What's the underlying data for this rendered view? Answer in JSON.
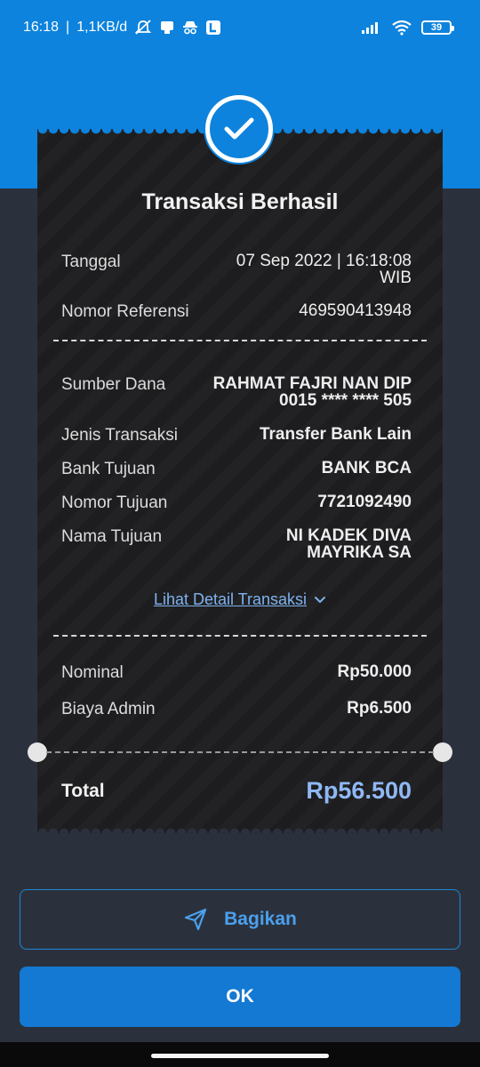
{
  "status_bar": {
    "time": "16:18",
    "separator": "|",
    "speed": "1,1KB/d",
    "battery": "39"
  },
  "receipt": {
    "title": "Transaksi Berhasil",
    "rows_top": [
      {
        "label": "Tanggal",
        "value_lines": [
          "07 Sep 2022 | 16:18:08",
          "WIB"
        ]
      },
      {
        "label": "Nomor Referensi",
        "value_lines": [
          "469590413948"
        ]
      }
    ],
    "rows_middle": [
      {
        "label": "Sumber Dana",
        "value_lines": [
          "RAHMAT FAJRI NAN DIP",
          "0015 **** **** 505"
        ]
      },
      {
        "label": "Jenis Transaksi",
        "value_lines": [
          "Transfer Bank Lain"
        ]
      },
      {
        "label": "Bank Tujuan",
        "value_lines": [
          "BANK BCA"
        ]
      },
      {
        "label": "Nomor Tujuan",
        "value_lines": [
          "7721092490"
        ]
      },
      {
        "label": "Nama Tujuan",
        "value_lines": [
          "NI KADEK DIVA",
          "MAYRIKA SA"
        ]
      }
    ],
    "detail_link": "Lihat Detail Transaksi",
    "rows_bottom": [
      {
        "label": "Nominal",
        "value": "Rp50.000"
      },
      {
        "label": "Biaya Admin",
        "value": "Rp6.500"
      }
    ],
    "total_label": "Total",
    "total_value": "Rp56.500"
  },
  "actions": {
    "share_label": "Bagikan",
    "ok_label": "OK"
  },
  "colors": {
    "header_blue": "#0d83dd",
    "background": "#2b313c",
    "receipt": "#1d1d1f",
    "total_accent": "#8fb8f4",
    "button_blue": "#1379d3"
  },
  "icons": {
    "success": "check-icon",
    "share": "send-icon",
    "detail_toggle": "chevron-down-icon"
  }
}
